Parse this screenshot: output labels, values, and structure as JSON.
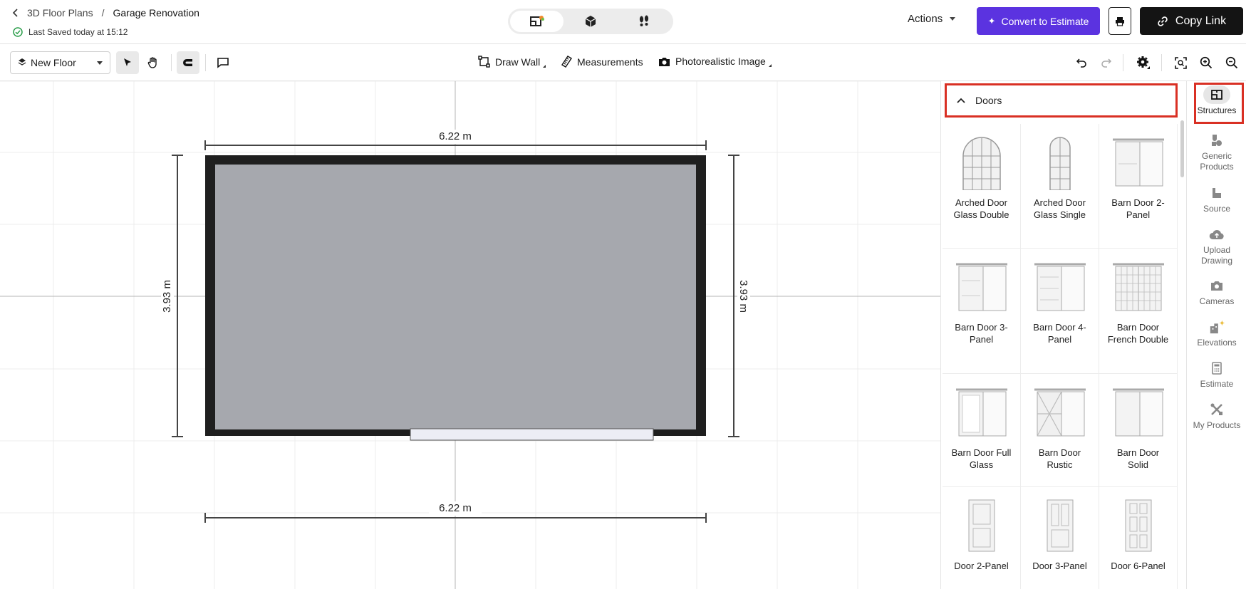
{
  "breadcrumb": {
    "parent": "3D Floor Plans",
    "separator": "/",
    "current": "Garage Renovation"
  },
  "save_status": "Last Saved today at 15:12",
  "view_modes": [
    "2d-plan-icon",
    "3d-box-icon",
    "walkthrough-footsteps-icon"
  ],
  "header": {
    "actions_label": "Actions",
    "convert_label": "Convert to Estimate",
    "copy_link_label": "Copy Link",
    "accent": "#5b33e0"
  },
  "toolbar": {
    "floor_label": "New Floor",
    "draw_wall_label": "Draw Wall",
    "measurements_label": "Measurements",
    "photo_label": "Photorealistic Image"
  },
  "plan": {
    "top_dimension": "6.22 m",
    "bottom_dimension": "6.22 m",
    "left_dimension": "3.93 m",
    "right_dimension": "3.93 m",
    "room_fill": "#a6a8ae",
    "wall_color": "#1f1f1f"
  },
  "panel": {
    "section_title": "Doors",
    "items": [
      {
        "label": "Arched Door Glass Double",
        "icon": "arched-double-door-icon"
      },
      {
        "label": "Arched Door Glass Single",
        "icon": "arched-single-door-icon"
      },
      {
        "label": "Barn Door 2-Panel",
        "icon": "barn-door-icon"
      },
      {
        "label": "Barn Door 3-Panel",
        "icon": "barn-door-icon"
      },
      {
        "label": "Barn Door 4-Panel",
        "icon": "barn-door-icon"
      },
      {
        "label": "Barn Door French Double",
        "icon": "barn-door-french-icon"
      },
      {
        "label": "Barn Door Full Glass",
        "icon": "barn-door-icon"
      },
      {
        "label": "Barn Door Rustic",
        "icon": "barn-door-rustic-icon"
      },
      {
        "label": "Barn Door Solid",
        "icon": "barn-door-icon"
      },
      {
        "label": "Door 2-Panel",
        "icon": "panel-door-icon"
      },
      {
        "label": "Door 3-Panel",
        "icon": "panel-door-icon"
      },
      {
        "label": "Door 6-Panel",
        "icon": "panel-door-icon"
      }
    ]
  },
  "rail": {
    "items": [
      {
        "label": "Structures",
        "icon": "structures-icon"
      },
      {
        "label": "Generic Products",
        "icon": "generic-products-icon"
      },
      {
        "label": "Source",
        "icon": "source-icon"
      },
      {
        "label": "Upload Drawing",
        "icon": "upload-cloud-icon"
      },
      {
        "label": "Cameras",
        "icon": "camera-icon"
      },
      {
        "label": "Elevations",
        "icon": "elevations-icon"
      },
      {
        "label": "Estimate",
        "icon": "calculator-icon"
      },
      {
        "label": "My Products",
        "icon": "my-products-icon"
      }
    ]
  }
}
